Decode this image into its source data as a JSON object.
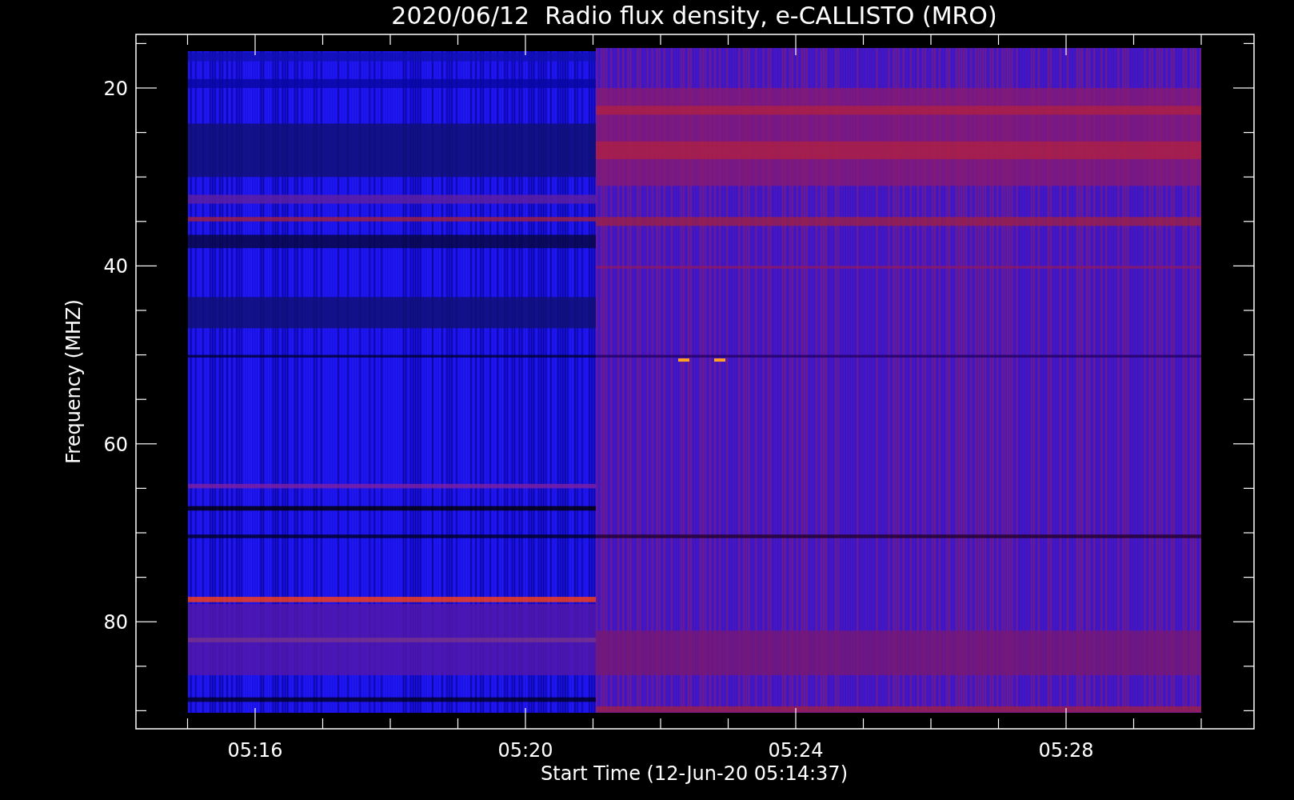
{
  "title": "2020/06/12  Radio flux density, e-CALLISTO (MRO)",
  "plot": {
    "ylabel": "Frequency (MHZ)",
    "yticks": [
      "20",
      "40",
      "60",
      "80"
    ],
    "xticks": [
      "05:16",
      "05:20",
      "05:24",
      "05:28"
    ],
    "xlabel": "Start Time (12-Jun-20 05:14:37)"
  }
}
